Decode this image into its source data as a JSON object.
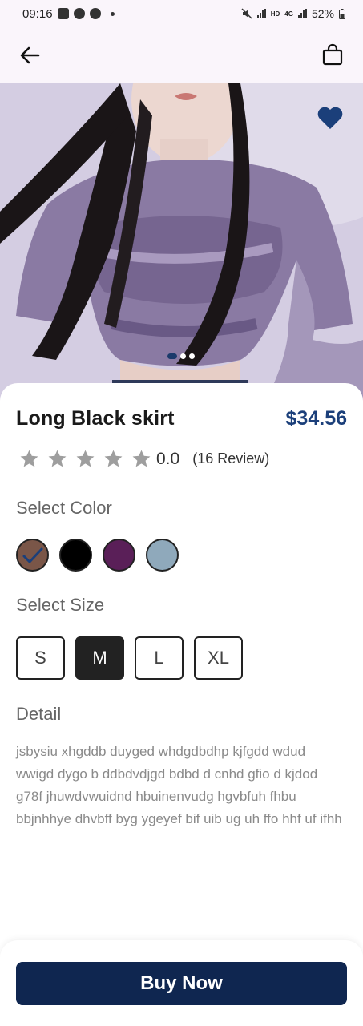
{
  "status_bar": {
    "time": "09:16",
    "network_badge": "HD",
    "network_type": "4G",
    "battery": "52%"
  },
  "header": {
    "back_icon": "arrow-left-icon",
    "bag_icon": "shopping-bag-icon"
  },
  "hero": {
    "favorite_icon": "heart-icon",
    "favorite_color": "#1b3f7a",
    "slide_count": 3,
    "active_slide": 1
  },
  "product": {
    "name": "Long Black skirt",
    "price": "$34.56",
    "rating": {
      "stars_total": 5,
      "stars_filled": 0,
      "value": "0.0",
      "reviews": "(16 Review)"
    },
    "select_color_label": "Select Color",
    "colors": [
      {
        "hex": "#7a5648",
        "selected": true
      },
      {
        "hex": "#000000",
        "selected": false
      },
      {
        "hex": "#5a1f58",
        "selected": false
      },
      {
        "hex": "#8fa9bb",
        "selected": false
      }
    ],
    "select_size_label": "Select Size",
    "sizes": [
      {
        "label": "S",
        "selected": false
      },
      {
        "label": "M",
        "selected": true
      },
      {
        "label": "L",
        "selected": false
      },
      {
        "label": "XL",
        "selected": false
      }
    ],
    "detail_label": "Detail",
    "detail_text": "jsbysiu xhgddb duyged whdgdbdhp  kjfgdd  wdud wwigd  dygo b ddbdvdjgd bdbd d cnhd gfio d kjdod g78f  jhuwdvwuidnd hbuinenvudg hgvbfuh fhbu  bbjnhhye dhvbff byg   ygeyef bif  uib  ug uh ffo hhf uf ifhh"
  },
  "actions": {
    "buy_now_label": "Buy Now",
    "accent": "#0f2650"
  }
}
